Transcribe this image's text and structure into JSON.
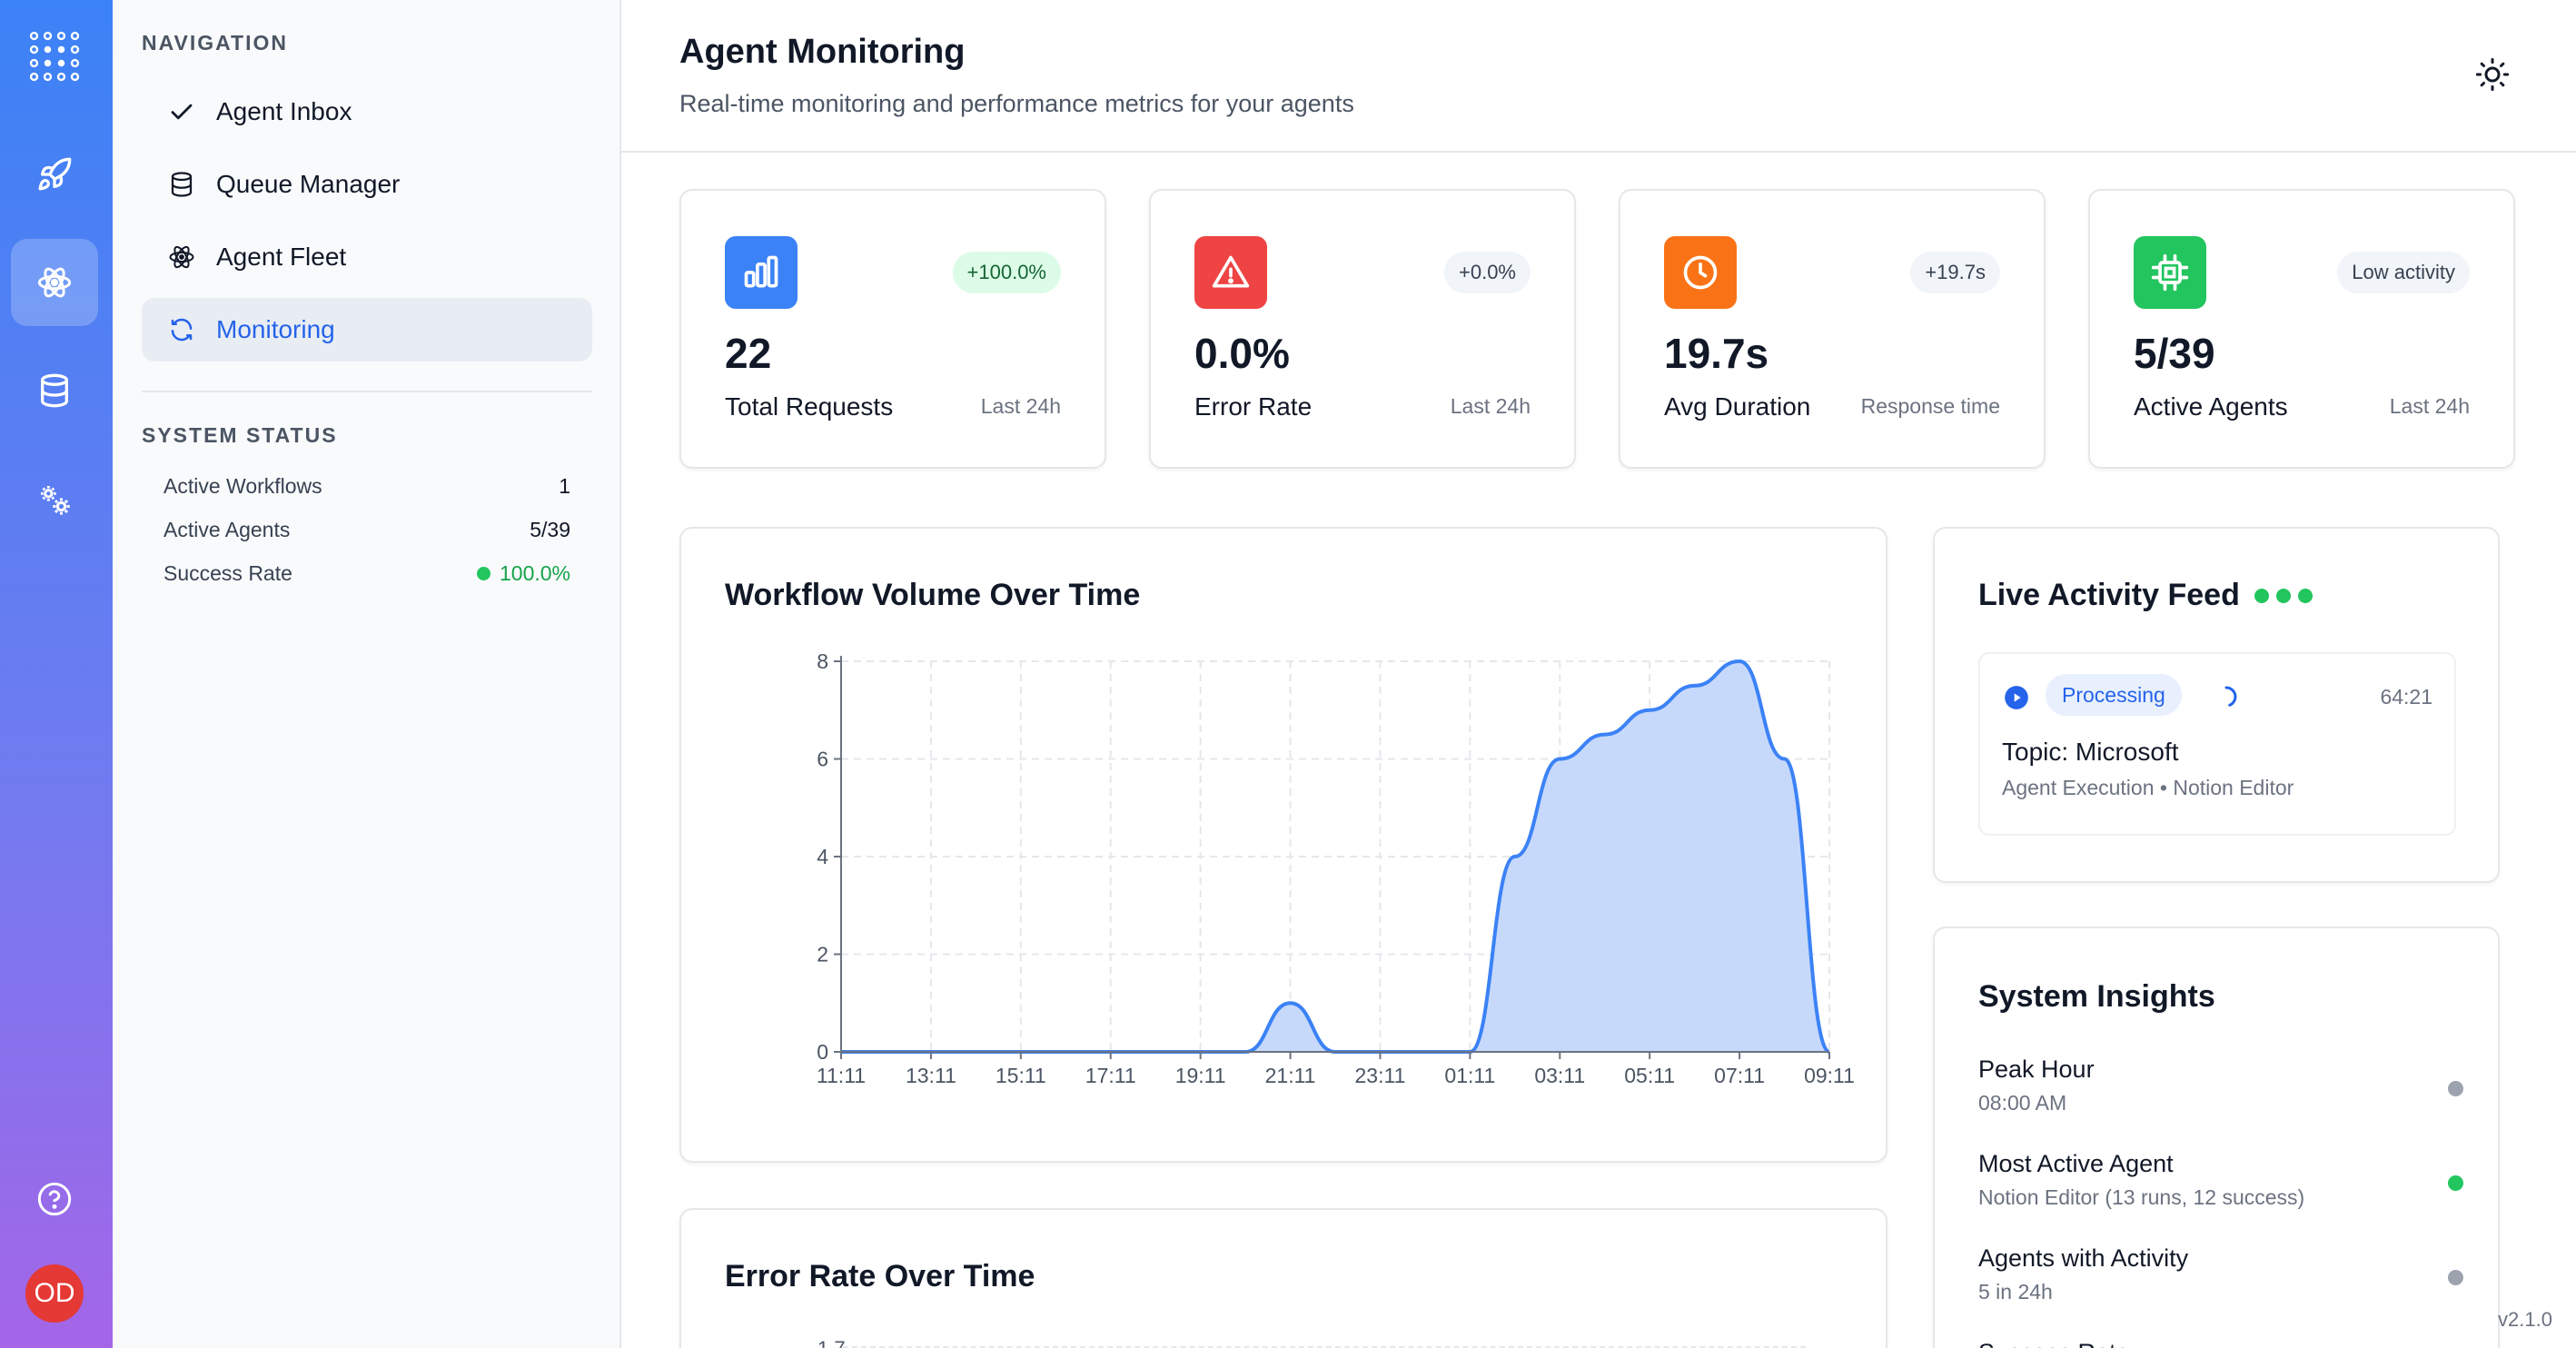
{
  "nav": {
    "heading": "NAVIGATION",
    "items": [
      {
        "label": "Agent Inbox",
        "icon": "check-icon",
        "active": false
      },
      {
        "label": "Queue Manager",
        "icon": "database-icon",
        "active": false
      },
      {
        "label": "Agent Fleet",
        "icon": "atom-icon",
        "active": false
      },
      {
        "label": "Monitoring",
        "icon": "refresh-icon",
        "active": true
      }
    ]
  },
  "system_status": {
    "heading": "SYSTEM STATUS",
    "rows": [
      {
        "label": "Active Workflows",
        "value": "1"
      },
      {
        "label": "Active Agents",
        "value": "5/39"
      },
      {
        "label": "Success Rate",
        "value": "100.0%"
      }
    ]
  },
  "header": {
    "title": "Agent Monitoring",
    "subtitle": "Real-time monitoring and performance metrics for your agents"
  },
  "stats": [
    {
      "value": "22",
      "label": "Total Requests",
      "badge": "+100.0%",
      "period": "Last 24h",
      "icon": "bar-chart-icon",
      "color": "#3b82f6"
    },
    {
      "value": "0.0%",
      "label": "Error Rate",
      "badge": "+0.0%",
      "period": "Last 24h",
      "icon": "warning-icon",
      "color": "#ef4444"
    },
    {
      "value": "19.7s",
      "label": "Avg Duration",
      "badge": "+19.7s",
      "period": "Response time",
      "icon": "clock-icon",
      "color": "#f97316"
    },
    {
      "value": "5/39",
      "label": "Active Agents",
      "badge": "Low activity",
      "period": "Last 24h",
      "icon": "cpu-icon",
      "color": "#22c55e"
    }
  ],
  "workflow_card": {
    "title": "Workflow Volume Over Time"
  },
  "error_card": {
    "title": "Error Rate Over Time",
    "partial_tick": "1.7"
  },
  "chart_data": [
    {
      "type": "area",
      "title": "Workflow Volume Over Time",
      "xlabel": "",
      "ylabel": "",
      "x": [
        "11:11",
        "12:11",
        "13:11",
        "14:11",
        "15:11",
        "16:11",
        "17:11",
        "18:11",
        "19:11",
        "20:11",
        "21:11",
        "22:11",
        "23:11",
        "00:11",
        "01:11",
        "02:11",
        "03:11",
        "04:11",
        "05:11",
        "06:11",
        "07:11",
        "08:11",
        "09:11"
      ],
      "x_tick_labels": [
        "11:11",
        "13:11",
        "15:11",
        "17:11",
        "19:11",
        "21:11",
        "23:11",
        "01:11",
        "03:11",
        "05:11",
        "07:11",
        "09:11"
      ],
      "values": [
        0,
        0,
        0,
        0,
        0,
        0,
        0,
        0,
        0,
        0,
        1,
        0,
        0,
        0,
        0,
        4,
        6,
        6.5,
        7,
        7.5,
        8,
        6,
        0
      ],
      "ylim": [
        0,
        8
      ],
      "y_ticks": [
        0,
        2,
        4,
        6,
        8
      ],
      "grid": true,
      "color": "#3b82f6"
    }
  ],
  "feed": {
    "title": "Live Activity Feed",
    "item": {
      "status": "Processing",
      "time": "64:21",
      "topic": "Topic: Microsoft",
      "meta": "Agent Execution • Notion Editor"
    }
  },
  "insights": {
    "title": "System Insights",
    "items": [
      {
        "title": "Peak Hour",
        "sub": "08:00 AM",
        "dot": "#9ca3af"
      },
      {
        "title": "Most Active Agent",
        "sub": "Notion Editor (13 runs, 12 success)",
        "dot": "#22c55e"
      },
      {
        "title": "Agents with Activity",
        "sub": "5 in 24h",
        "dot": "#9ca3af"
      },
      {
        "title": "Success Rate",
        "sub": "",
        "dot": "#9ca3af"
      }
    ]
  },
  "avatar_initials": "OD",
  "version": "v2.1.0"
}
